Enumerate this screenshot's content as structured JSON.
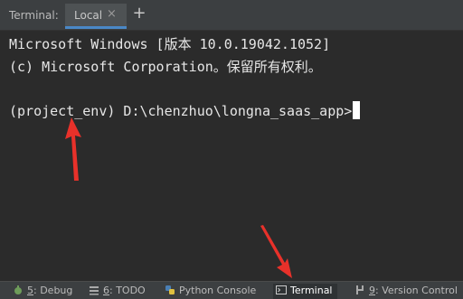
{
  "tabbar": {
    "title": "Terminal:",
    "tab_label": "Local",
    "close_glyph": "×",
    "add_glyph": "+"
  },
  "terminal": {
    "lines": [
      "Microsoft Windows [版本 10.0.19042.1052]",
      "(c) Microsoft Corporation。保留所有权利。",
      "",
      "(project_env) D:\\chenzhuo\\longna_saas_app>"
    ]
  },
  "statusbar": {
    "items": [
      {
        "num": "5",
        "label": ": Debug",
        "icon": "debug-icon"
      },
      {
        "num": "6",
        "label": ": TODO",
        "icon": "todo-icon"
      },
      {
        "num": "",
        "label": "Python Console",
        "icon": "python-icon"
      },
      {
        "num": "",
        "label": "Terminal",
        "icon": "terminal-icon"
      },
      {
        "num": "9",
        "label": ": Version Control",
        "icon": "version-control-icon"
      }
    ]
  },
  "colors": {
    "background": "#2b2b2b",
    "text": "#e6e6e6",
    "arrow": "#e8312a",
    "tab_accent": "#4a88c7"
  }
}
